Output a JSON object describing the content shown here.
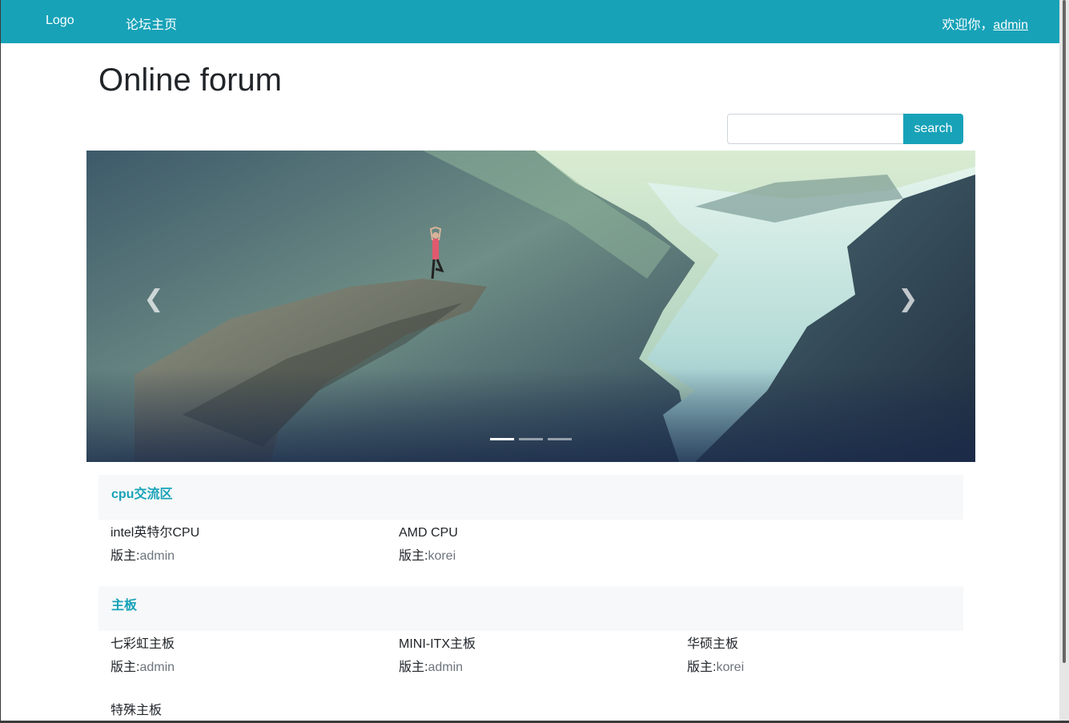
{
  "navbar": {
    "brand": "Logo",
    "forum_home": "论坛主页",
    "welcome_prefix": "欢迎你，",
    "username": "admin"
  },
  "page_title": "Online forum",
  "search": {
    "value": "",
    "button": "search"
  },
  "carousel": {
    "slide_count": 3,
    "active_index": 0
  },
  "moderator_prefix": "版主:",
  "sections": [
    {
      "title": "cpu交流区",
      "boards": [
        {
          "name": "intel英特尔CPU",
          "moderator": "admin"
        },
        {
          "name": "AMD CPU",
          "moderator": "korei"
        }
      ]
    },
    {
      "title": "主板",
      "boards": [
        {
          "name": "七彩虹主板",
          "moderator": "admin"
        },
        {
          "name": "MINI-ITX主板",
          "moderator": "admin"
        },
        {
          "name": "华硕主板",
          "moderator": "korei"
        },
        {
          "name": "特殊主板"
        }
      ]
    }
  ],
  "colors": {
    "accent": "#17a2b8",
    "section_bg": "#f7f8f9",
    "muted": "#6c757d"
  }
}
